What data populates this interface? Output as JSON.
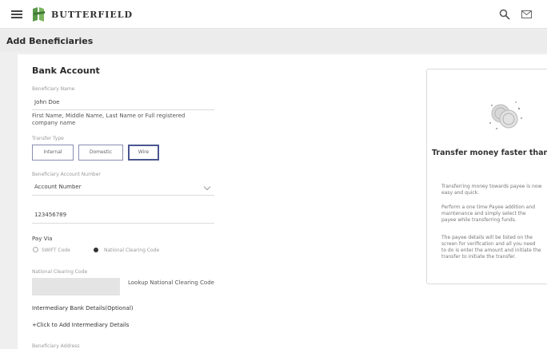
{
  "app": {
    "brand": "BUTTERFIELD",
    "page_title": "Add Beneficiaries"
  },
  "form": {
    "section_title": "Bank Account",
    "beneficiary_name": {
      "label": "Beneficiary Name",
      "value": "John Doe",
      "hint": "First Name, Middle Name, Last Name or Full registered company name"
    },
    "transfer_type": {
      "label": "Transfer Type",
      "options": [
        "Internal",
        "Domestic",
        "Wire"
      ],
      "selected": "Wire"
    },
    "account_number": {
      "label": "Beneficiary Account Number",
      "select_value": "Account Number",
      "value": "123456789"
    },
    "pay_via": {
      "label": "Pay Via",
      "options": [
        "SWIFT Code",
        "National Clearing Code"
      ],
      "selected": "National Clearing Code"
    },
    "clearing_code": {
      "label": "National Clearing Code",
      "lookup_label": "Lookup National Clearing Code"
    },
    "intermediary": {
      "title": "Intermediary Bank Details(Optional)",
      "add_link": "Click to Add Intermediary Details"
    },
    "beneficiary_address_label": "Beneficiary Address"
  },
  "side_panel": {
    "title": "Transfer money faster than ever!",
    "paragraphs": [
      [
        "Transferring money towards payee is now",
        "easy and quick."
      ],
      [
        "Perform a one time Payee addition and",
        "maintenance and simply select the",
        "payee while transferring funds."
      ],
      [
        "The payee details will be listed on the",
        "screen for verification and all you need",
        "to do is enter the amount and initiate the",
        "transfer to initiate the transfer."
      ]
    ]
  },
  "icons": {
    "menu": "hamburger-icon",
    "logo": "butterfield-logo",
    "search": "search-icon",
    "mail": "mail-icon",
    "coins": "coins-icon"
  },
  "colors": {
    "accent": "#4a5590",
    "logo_green": "#5a9a4a"
  }
}
